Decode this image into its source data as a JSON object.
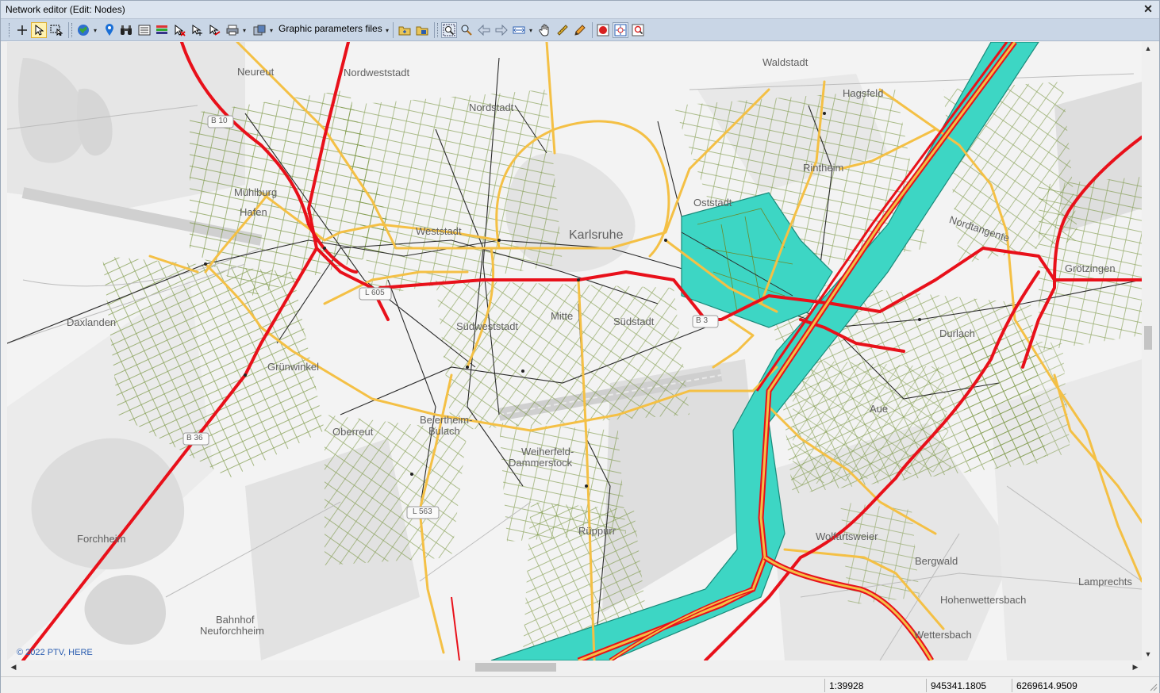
{
  "window": {
    "title": "Network editor (Edit: Nodes)",
    "close_glyph": "✕"
  },
  "toolbar": {
    "graphic_params_label": "Graphic parameters files",
    "icons": [
      "insert-icon",
      "select-pointer-icon",
      "select-rect-icon",
      "globe-icon",
      "location-pin-icon",
      "binoculars-icon",
      "list-icon",
      "color-bars-icon",
      "select-tool-red-icon",
      "move-node-icon",
      "edit-link-icon",
      "print-icon",
      "copy-image-icon",
      "open-folder-icon",
      "save-folder-icon",
      "zoom-extent-icon",
      "zoom-icon",
      "back-icon",
      "forward-icon",
      "scale-icon",
      "pan-hand-icon",
      "measure-ruler-icon",
      "pencil-icon",
      "stop-record-icon",
      "fit-network-icon",
      "search-map-icon"
    ]
  },
  "map": {
    "copyright": "© 2022 PTV, HERE",
    "labels": {
      "neureut": "Neureut",
      "nordweststadt": "Nordweststadt",
      "nordstadt": "Nordstadt",
      "waldstadt": "Waldstadt",
      "hagsfeld": "Hagsfeld",
      "rintheim": "Rintheim",
      "oststadt": "Oststadt",
      "muehlburg": "Mühlburg",
      "hafen": "Hafen",
      "weststadt": "Weststadt",
      "karlsruhe": "Karlsruhe",
      "daxlanden": "Daxlanden",
      "suedweststadt": "Südweststadt",
      "mitte": "Mitte",
      "suedstadt": "Südstadt",
      "gruenwinkel": "Grünwinkel",
      "beiertheim": "Beiertheim-",
      "bulach": "Bulach",
      "oberreut": "Oberreut",
      "weiherfeld": "Weiherfeld-",
      "dammerstock": "Dammerstock",
      "aue": "Aue",
      "durlach": "Durlach",
      "grötzingen": "Grötzingen",
      "hohenwettersbach": "Hohenwettersbach",
      "bergwald": "Bergwald",
      "wolfartsweier": "Wolfartsweier",
      "rueppurr": "Rüppurr",
      "forchheim": "Forchheim",
      "bahnhof": "Bahnhof",
      "neuforchheim": "Neuforchheim",
      "wettersbach": "Wettersbach",
      "lamprechts": "Lamprechts",
      "nordtangente": "Nordtangente",
      "b10": "B 10",
      "b36": "B 36",
      "l605": "L 605",
      "b3": "B 3",
      "l563": "L 563"
    }
  },
  "status": {
    "scale": "1:39928",
    "x": "945341.1805",
    "y": "6269614.9509"
  },
  "colors": {
    "motorway": "#e8101a",
    "primary": "#f4c045",
    "zone_fill": "#3dd6c4",
    "local": "#6a8a2c",
    "pt_line": "#2a2a2a"
  }
}
